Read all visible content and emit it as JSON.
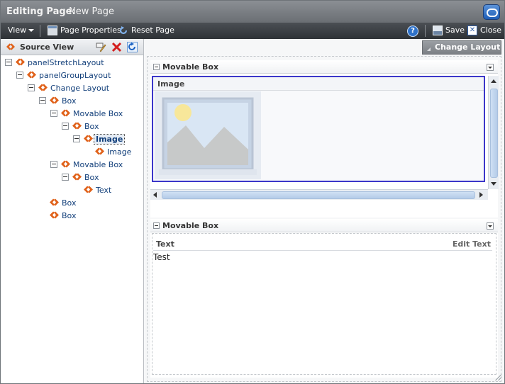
{
  "titlebar": {
    "title_bold": "Editing Page:",
    "title_name": "New Page"
  },
  "toolbar": {
    "view_label": "View",
    "page_properties_label": "Page Properties",
    "reset_page_label": "Reset Page",
    "save_label": "Save",
    "close_label": "Close",
    "help_glyph": "?",
    "close_glyph": "✕"
  },
  "left_pane": {
    "title": "Source View",
    "tree": [
      {
        "label": "panelStretchLayout",
        "level": 0,
        "toggle": true,
        "selected": false
      },
      {
        "label": "panelGroupLayout",
        "level": 1,
        "toggle": true,
        "selected": false
      },
      {
        "label": "Change Layout",
        "level": 2,
        "toggle": true,
        "selected": false
      },
      {
        "label": "Box",
        "level": 3,
        "toggle": true,
        "selected": false
      },
      {
        "label": "Movable Box",
        "level": 4,
        "toggle": true,
        "selected": false
      },
      {
        "label": "Box",
        "level": 5,
        "toggle": true,
        "selected": false
      },
      {
        "label": "Image",
        "level": 6,
        "toggle": true,
        "selected": true
      },
      {
        "label": "Image",
        "level": 7,
        "toggle": false,
        "selected": false
      },
      {
        "label": "Movable Box",
        "level": 4,
        "toggle": true,
        "selected": false
      },
      {
        "label": "Box",
        "level": 5,
        "toggle": true,
        "selected": false
      },
      {
        "label": "Text",
        "level": 6,
        "toggle": false,
        "selected": false
      },
      {
        "label": "Box",
        "level": 3,
        "toggle": false,
        "selected": false
      },
      {
        "label": "Box",
        "level": 3,
        "toggle": false,
        "selected": false
      }
    ]
  },
  "right_pane": {
    "change_layout_label": "Change Layout",
    "box1": {
      "title": "Movable Box",
      "image_header": "Image"
    },
    "box2": {
      "title": "Movable Box",
      "text_header": "Text",
      "edit_text_label": "Edit Text",
      "content": "Test"
    }
  },
  "colors": {
    "selection_border": "#3b36c9",
    "link_text": "#123f7a",
    "toolbar_bg": "#2e3236"
  }
}
